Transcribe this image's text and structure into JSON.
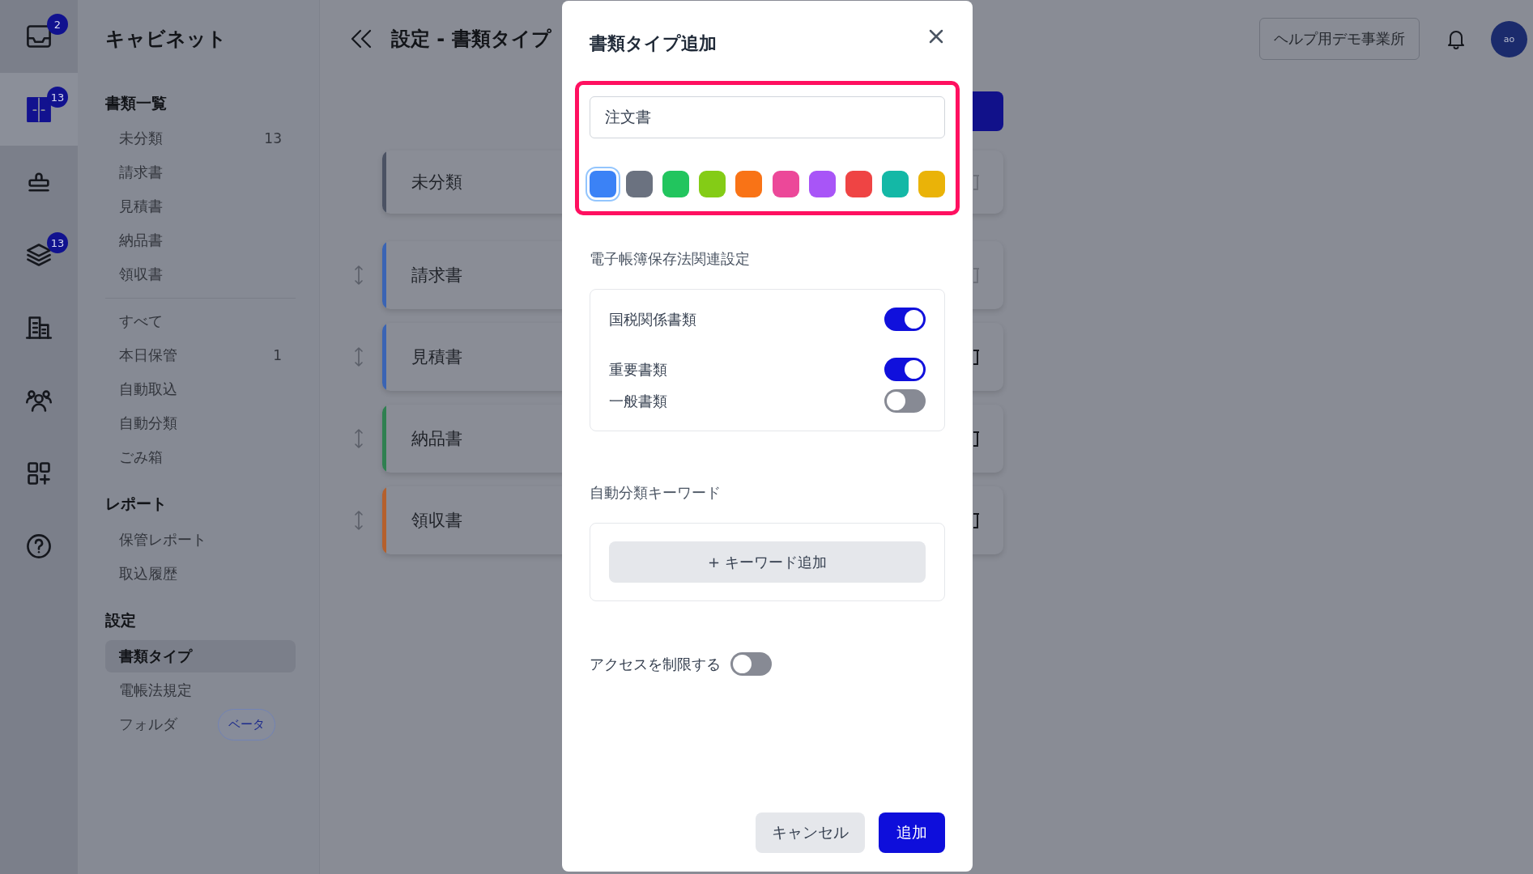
{
  "rail": {
    "items": [
      {
        "badge": "2",
        "selected": false
      },
      {
        "badge": "13",
        "selected": true
      },
      {
        "selected": false
      },
      {
        "badge": "13",
        "selected": false
      },
      {
        "selected": false
      },
      {
        "selected": false
      },
      {
        "selected": false
      },
      {
        "selected": false
      }
    ]
  },
  "sidebar": {
    "title": "キャビネット",
    "groups": [
      {
        "heading": "書類一覧",
        "items": [
          {
            "label": "未分類",
            "count": "13",
            "selected": false
          },
          {
            "label": "請求書",
            "selected": false
          },
          {
            "label": "見積書",
            "selected": false
          },
          {
            "label": "納品書",
            "selected": false
          },
          {
            "label": "領収書",
            "selected": false
          }
        ]
      },
      {
        "items": [
          {
            "label": "すべて",
            "selected": false
          },
          {
            "label": "本日保管",
            "count": "1",
            "selected": false
          },
          {
            "label": "自動取込",
            "selected": false
          },
          {
            "label": "自動分類",
            "selected": false
          },
          {
            "label": "ごみ箱",
            "selected": false
          }
        ]
      },
      {
        "heading": "レポート",
        "items": [
          {
            "label": "保管レポート",
            "selected": false
          },
          {
            "label": "取込履歴",
            "selected": false
          }
        ]
      },
      {
        "heading": "設定",
        "items": [
          {
            "label": "書類タイプ",
            "selected": true
          },
          {
            "label": "電帳法規定",
            "selected": false
          },
          {
            "label": "フォルダ",
            "badge": "ベータ",
            "selected": false
          }
        ]
      }
    ]
  },
  "header": {
    "title": "設定 - 書類タイプ",
    "office_button": "ヘルプ用デモ事業所",
    "avatar": "ao"
  },
  "document_types": [
    {
      "name": "未分類",
      "color": "#4b5263",
      "draggable": false,
      "delete_enabled": false
    },
    {
      "name": "請求書",
      "color": "#3a64b4",
      "draggable": true,
      "delete_enabled": false
    },
    {
      "name": "見積書",
      "color": "#3a64b4",
      "draggable": true,
      "delete_enabled": true
    },
    {
      "name": "納品書",
      "color": "#2f8050",
      "draggable": true,
      "delete_enabled": true
    },
    {
      "name": "領収書",
      "color": "#b5602c",
      "draggable": true,
      "delete_enabled": true
    }
  ],
  "dialog": {
    "title": "書類タイプ追加",
    "highlighted": true,
    "name_field": {
      "value": "注文書"
    },
    "colors": [
      {
        "color": "#3b82f6",
        "selected": true
      },
      {
        "color": "#6b7280",
        "selected": false
      },
      {
        "color": "#22c55e",
        "selected": false
      },
      {
        "color": "#84cc16",
        "selected": false
      },
      {
        "color": "#f97316",
        "selected": false
      },
      {
        "color": "#ec4899",
        "selected": false
      },
      {
        "color": "#a855f7",
        "selected": false
      },
      {
        "color": "#ef4444",
        "selected": false
      },
      {
        "color": "#14b8a6",
        "selected": false
      },
      {
        "color": "#eab308",
        "selected": false
      }
    ],
    "ledger_settings": {
      "heading": "電子帳簿保存法関連設定",
      "toggles": [
        {
          "label": "国税関係書類",
          "on": true
        },
        {
          "label": "重要書類",
          "on": true
        },
        {
          "label": "一般書類",
          "on": false
        }
      ]
    },
    "keywords": {
      "heading": "自動分類キーワード",
      "add_button": "+ キーワード追加"
    },
    "restrict_access": {
      "label": "アクセスを制限する",
      "on": false
    },
    "buttons": {
      "cancel": "キャンセル",
      "confirm": "追加"
    }
  }
}
